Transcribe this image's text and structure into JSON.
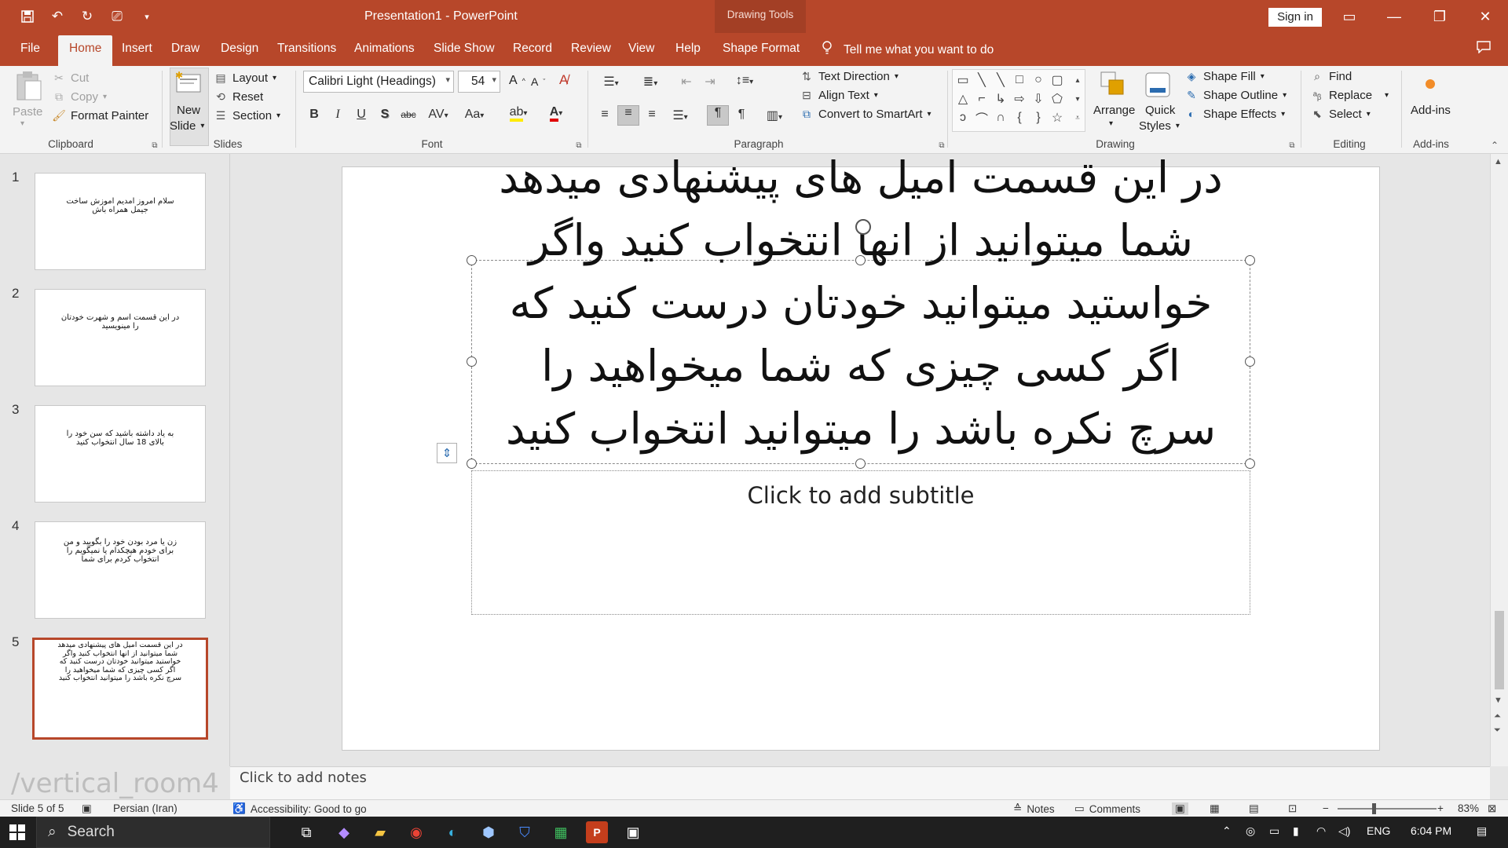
{
  "app": {
    "window_title": "Presentation1 - PowerPoint",
    "context_tab_group": "Drawing Tools",
    "sign_in": "Sign in"
  },
  "tabs": [
    "File",
    "Home",
    "Insert",
    "Draw",
    "Design",
    "Transitions",
    "Animations",
    "Slide Show",
    "Record",
    "Review",
    "View",
    "Help",
    "Shape Format"
  ],
  "active_tab": "Home",
  "tell_me": "Tell me what you want to do",
  "ribbon": {
    "clipboard": {
      "label": "Clipboard",
      "paste": "Paste",
      "cut": "Cut",
      "copy": "Copy",
      "format_painter": "Format Painter"
    },
    "slides": {
      "label": "Slides",
      "new_slide_1": "New",
      "new_slide_2": "Slide",
      "layout": "Layout",
      "reset": "Reset",
      "section": "Section"
    },
    "font": {
      "label": "Font",
      "font_name": "Calibri Light (Headings)",
      "font_size": "54",
      "grow": "A",
      "shrink": "A"
    },
    "paragraph": {
      "label": "Paragraph",
      "text_direction": "Text Direction",
      "align_text": "Align Text",
      "convert_smartart": "Convert to SmartArt"
    },
    "drawing": {
      "label": "Drawing",
      "arrange": "Arrange",
      "quick_styles_1": "Quick",
      "quick_styles_2": "Styles",
      "shape_fill": "Shape Fill",
      "shape_outline": "Shape Outline",
      "shape_effects": "Shape Effects"
    },
    "editing": {
      "label": "Editing",
      "find": "Find",
      "replace": "Replace",
      "select": "Select"
    },
    "addins": {
      "label": "Add-ins",
      "addins": "Add-ins"
    }
  },
  "slides": [
    {
      "number": "1",
      "text": "سلام امروز امدیم اموزش ساخت\nجیمل همراه باش"
    },
    {
      "number": "2",
      "text": "در این قسمت اسم و شهرت خودتان\nرا مینویسید"
    },
    {
      "number": "3",
      "text": "به یاد داشته باشید که سن خود را\nبالای 18 سال انتخواب کنید"
    },
    {
      "number": "4",
      "text": "زن یا مرد بودن خود را بگویید و من\nبرای خودم هیچکدام یا نمیگویم را\nانتخواب کردم برای شما"
    },
    {
      "number": "5",
      "text": "در این قسمت امیل های پیشنهادی میدهد\nشما میتوانید از انها انتخواب کنید واگر\nخواستید میتوانید خودتان  درست کنید که\nاگر کسی چیزی که شما میخواهید را\nسرچ نکره باشد را میتوانید انتخواب کنید"
    }
  ],
  "current_slide": {
    "title": "در این قسمت امیل های پیشنهادی میدهد\nشما میتوانید از انها انتخواب کنید واگر\nخواستید میتوانید خودتان  درست کنید که\nاگر کسی چیزی که شما میخواهید را\nسرچ نکره باشد را میتوانید انتخواب کنید",
    "subtitle_placeholder": "Click to add subtitle"
  },
  "notes_placeholder": "Click to add notes",
  "watermark": "/vertical_room4",
  "status": {
    "slide_counter": "Slide 5 of 5",
    "language": "Persian (Iran)",
    "accessibility": "Accessibility: Good to go",
    "notes": "Notes",
    "comments": "Comments",
    "zoom": "83%"
  },
  "taskbar": {
    "search": "Search",
    "language": "ENG",
    "time": "6:04 PM"
  },
  "colors": {
    "accent": "#b7472a",
    "ribbon_bg": "#f3f3f3",
    "canvas_bg": "#e6e6e6"
  }
}
